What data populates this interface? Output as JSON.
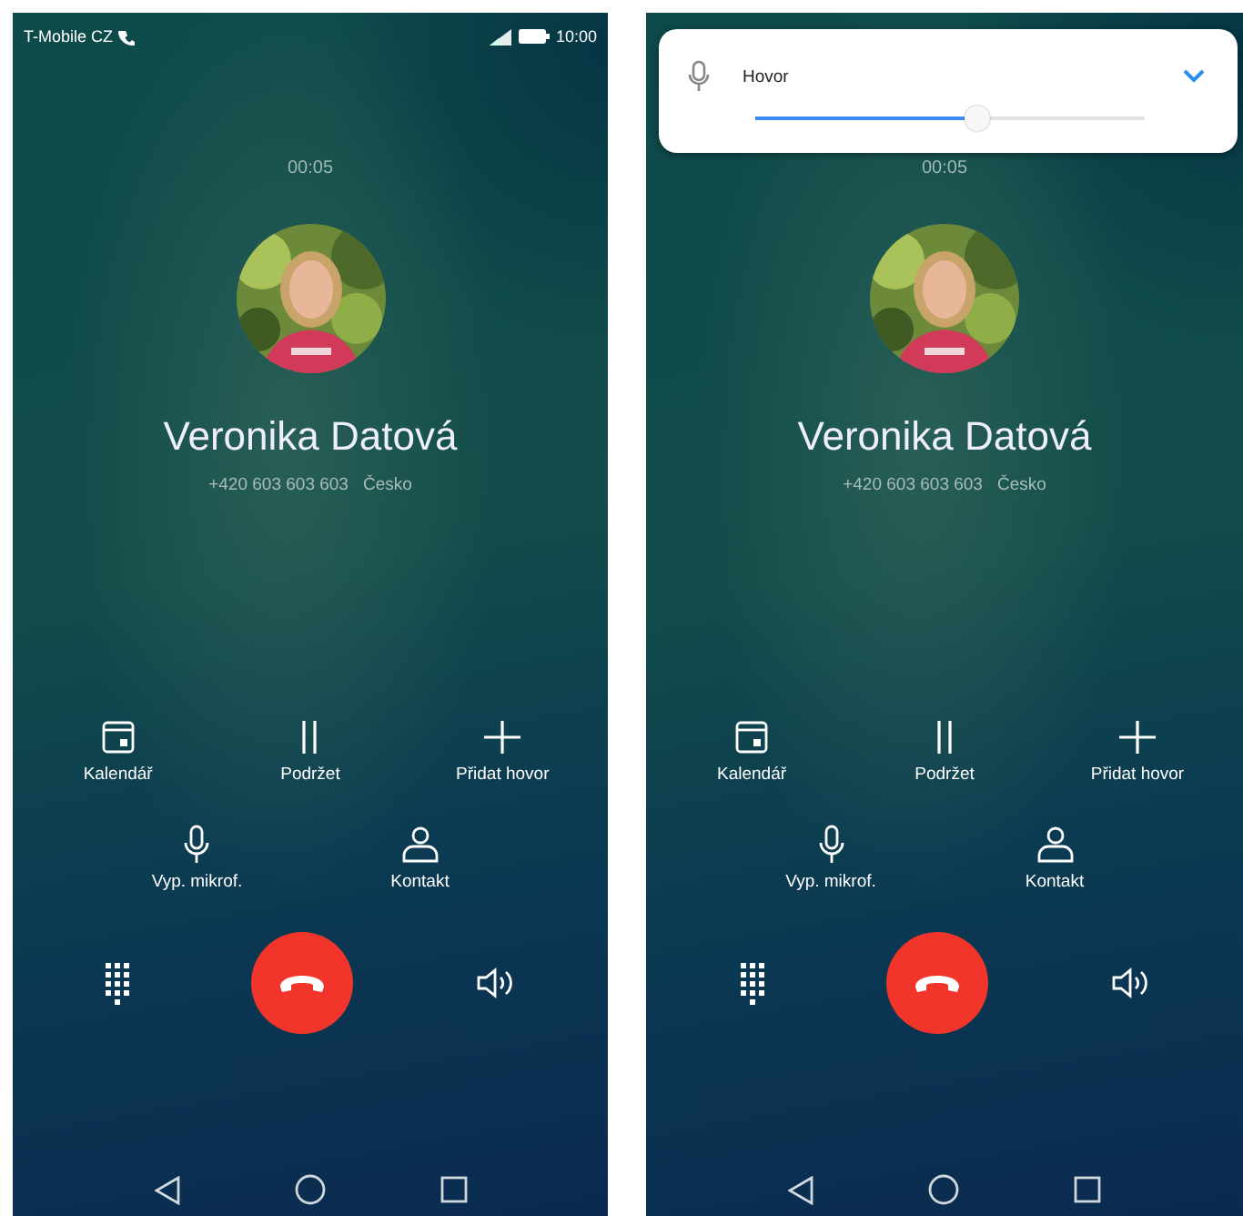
{
  "phones": [
    {
      "status_bar": {
        "carrier": "T-Mobile CZ",
        "time": "10:00"
      },
      "call": {
        "timer": "00:05",
        "name": "Veronika Datová",
        "number": "+420 603 603 603",
        "country": "Česko"
      },
      "actions": [
        {
          "kind": "calendar",
          "label": "Kalendář"
        },
        {
          "kind": "hold",
          "label": "Podržet"
        },
        {
          "kind": "add",
          "label": "Přidat hovor"
        }
      ],
      "actions_2": [
        {
          "kind": "mic",
          "label": "Vyp. mikrof."
        },
        {
          "kind": "contact",
          "label": "Kontakt"
        }
      ]
    },
    {
      "volume_panel": {
        "label": "Hovor",
        "level": 0.57
      },
      "call": {
        "timer": "00:05",
        "name": "Veronika Datová",
        "number": "+420 603 603 603",
        "country": "Česko"
      },
      "actions": [
        {
          "kind": "calendar",
          "label": "Kalendář"
        },
        {
          "kind": "hold",
          "label": "Podržet"
        },
        {
          "kind": "add",
          "label": "Přidat hovor"
        }
      ],
      "actions_2": [
        {
          "kind": "mic",
          "label": "Vyp. mikrof."
        },
        {
          "kind": "contact",
          "label": "Kontakt"
        }
      ]
    }
  ]
}
